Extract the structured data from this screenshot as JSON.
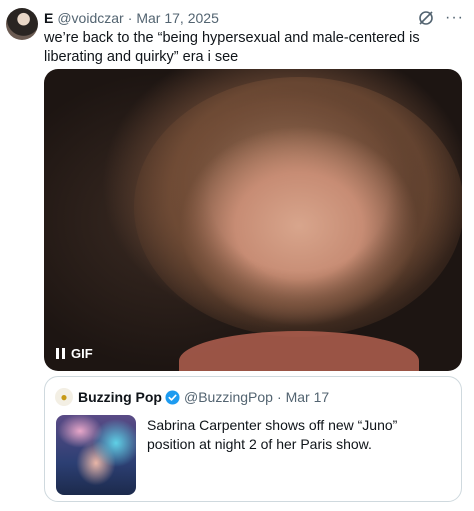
{
  "tweet": {
    "author_name": "E",
    "handle": "@voidczar",
    "separator": "·",
    "date": "Mar 17, 2025",
    "text": "we’re back to the “being hypersexual and male-centered is liberating and quirky” era i see",
    "media": {
      "badge_label": "GIF",
      "state_icon": "pause-icon"
    },
    "icons": [
      "grok-icon",
      "more-icon"
    ],
    "more_label": "···"
  },
  "quoted_tweet": {
    "author_name": "Buzzing Pop",
    "verified": true,
    "handle": "@BuzzingPop",
    "separator": "·",
    "date": "Mar 17",
    "text": "Sabrina Carpenter shows off new “Juno” position at night 2 of her Paris show.",
    "avatar_icon": "bee-icon"
  },
  "colors": {
    "text_primary": "#0f1419",
    "text_secondary": "#536471",
    "verified_blue": "#1d9bf0",
    "border": "#cfd9de"
  }
}
